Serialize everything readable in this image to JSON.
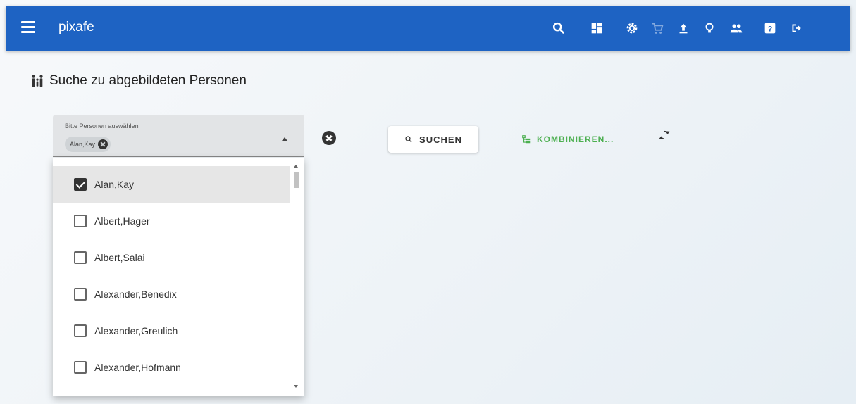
{
  "app": {
    "title": "pixafe"
  },
  "toolbar": {
    "icons": [
      "search-icon",
      "dashboard-icon",
      "settings-icon",
      "cart-icon",
      "upload-icon",
      "lightbulb-icon",
      "people-icon",
      "help-icon",
      "logout-icon"
    ],
    "accent": "#1e63c3"
  },
  "page": {
    "heading": "Suche zu abgebildeten Personen"
  },
  "person_select": {
    "label": "Bitte Personen auswählen",
    "chips": [
      "Alan,Kay"
    ],
    "options": [
      {
        "label": "Alan,Kay",
        "checked": true
      },
      {
        "label": "Albert,Hager",
        "checked": false
      },
      {
        "label": "Albert,Salai",
        "checked": false
      },
      {
        "label": "Alexander,Benedix",
        "checked": false
      },
      {
        "label": "Alexander,Greulich",
        "checked": false
      },
      {
        "label": "Alexander,Hofmann",
        "checked": false
      }
    ]
  },
  "actions": {
    "search_label": "SUCHEN",
    "combine_label": "KOMBINIEREN...",
    "combine_color": "#4caf50"
  }
}
